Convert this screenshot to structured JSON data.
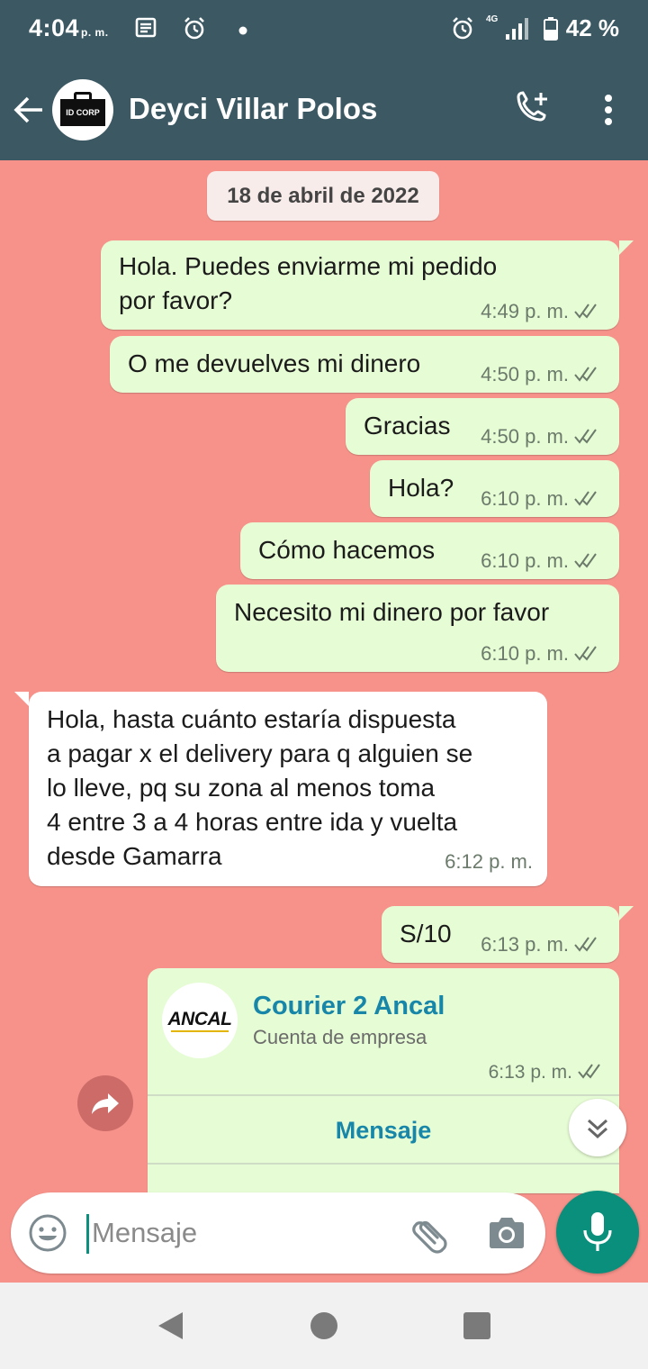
{
  "status_bar": {
    "time": "4:04",
    "ampm": "p. m.",
    "network": "4G",
    "battery": "42 %"
  },
  "header": {
    "avatar_text": "ID CORP",
    "contact_name": "Deyci Villar Polos",
    "icons": [
      "back-arrow-icon",
      "add-call-icon",
      "more-vert-icon"
    ]
  },
  "chat": {
    "date_chip": "18 de abril de 2022",
    "messages": [
      {
        "dir": "out",
        "text_lines": [
          "Hola. Puedes enviarme mi pedido",
          "por favor?"
        ],
        "time": "4:49 p. m.",
        "read": true
      },
      {
        "dir": "out",
        "text": "O me devuelves mi dinero",
        "time": "4:50 p. m.",
        "read": true
      },
      {
        "dir": "out",
        "text": "Gracias",
        "time": "4:50 p. m.",
        "read": true
      },
      {
        "dir": "out",
        "text": "Hola?",
        "time": "6:10 p. m.",
        "read": true
      },
      {
        "dir": "out",
        "text": "Cómo hacemos",
        "time": "6:10 p. m.",
        "read": true
      },
      {
        "dir": "out",
        "text": "Necesito mi dinero por favor",
        "time": "6:10 p. m.",
        "read": true
      },
      {
        "dir": "in",
        "text_lines": [
          "Hola, hasta cuánto estaría dispuesta",
          "a pagar x el delivery para q alguien se",
          "lo lleve, pq su zona al menos toma",
          "4 entre 3 a 4 horas entre ida y vuelta",
          "desde Gamarra"
        ],
        "time": "6:12 p. m."
      },
      {
        "dir": "out",
        "text": "S/10",
        "time": "6:13 p. m.",
        "read": true
      }
    ],
    "contact_card": {
      "logo_text": "ANCAL",
      "name": "Courier 2 Ancal",
      "subtitle": "Cuenta de empresa",
      "time": "6:13 p. m.",
      "button_label": "Mensaje"
    }
  },
  "composer": {
    "placeholder": "Mensaje",
    "value": ""
  },
  "colors": {
    "header": "#3b5863",
    "chat_bg": "#f6928a",
    "outgoing_bubble": "#e6fcd4",
    "incoming_bubble": "#ffffff",
    "accent": "#0a8f7c",
    "link": "#1786a8"
  }
}
